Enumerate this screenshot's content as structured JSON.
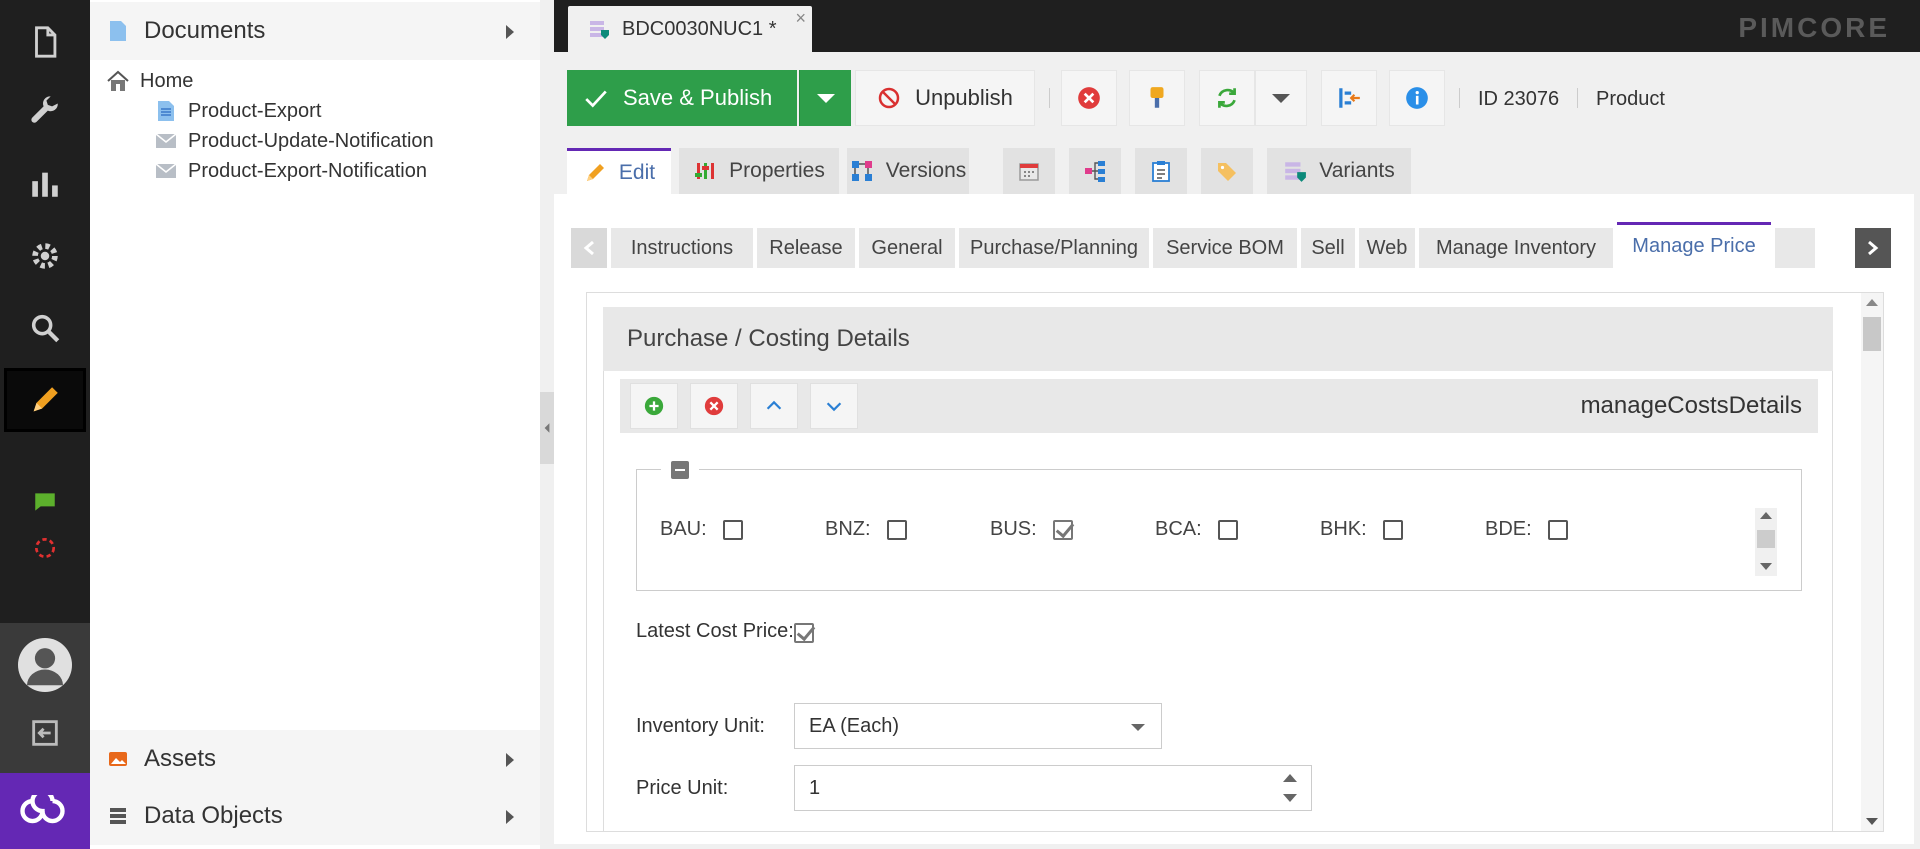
{
  "tree": {
    "documents_header": "Documents",
    "assets_header": "Assets",
    "data_objects_header": "Data Objects",
    "items": [
      {
        "label": "Home",
        "icon": "home-icon"
      },
      {
        "label": "Product-Export",
        "icon": "document-icon"
      },
      {
        "label": "Product-Update-Notification",
        "icon": "email-icon"
      },
      {
        "label": "Product-Export-Notification",
        "icon": "email-icon"
      }
    ]
  },
  "top": {
    "tab_title": "BDC0030NUC1 *",
    "tab_close": "×",
    "brand": "PIMCORE"
  },
  "toolbar": {
    "save_label": "Save & Publish",
    "unpublish_label": "Unpublish",
    "id_text": "ID 23076",
    "class_text": "Product"
  },
  "editor_tabs": {
    "edit": "Edit",
    "properties": "Properties",
    "versions": "Versions",
    "variants": "Variants"
  },
  "sub_tabs": [
    "Instructions",
    "Release",
    "General",
    "Purchase/Planning",
    "Service BOM",
    "Sell",
    "Web",
    "Manage Inventory",
    "Manage Price"
  ],
  "sub_tabs_active": "Manage Price",
  "panel": {
    "title": "Purchase / Costing Details",
    "collection_title": "manageCostsDetails"
  },
  "checkboxes": [
    {
      "label": "BAU:",
      "checked": false
    },
    {
      "label": "BNZ:",
      "checked": false
    },
    {
      "label": "BUS:",
      "checked": true
    },
    {
      "label": "BCA:",
      "checked": false
    },
    {
      "label": "BHK:",
      "checked": false
    },
    {
      "label": "BDE:",
      "checked": false
    }
  ],
  "form": {
    "latest_cost_label": "Latest Cost Price:",
    "latest_cost_checked": true,
    "inventory_unit_label": "Inventory Unit:",
    "inventory_unit_value": "EA (Each)",
    "price_unit_label": "Price Unit:",
    "price_unit_value": "1"
  },
  "colors": {
    "accent": "#6428b4",
    "save_green": "#2e9e4a",
    "nav_bg": "#1f1f1f"
  }
}
